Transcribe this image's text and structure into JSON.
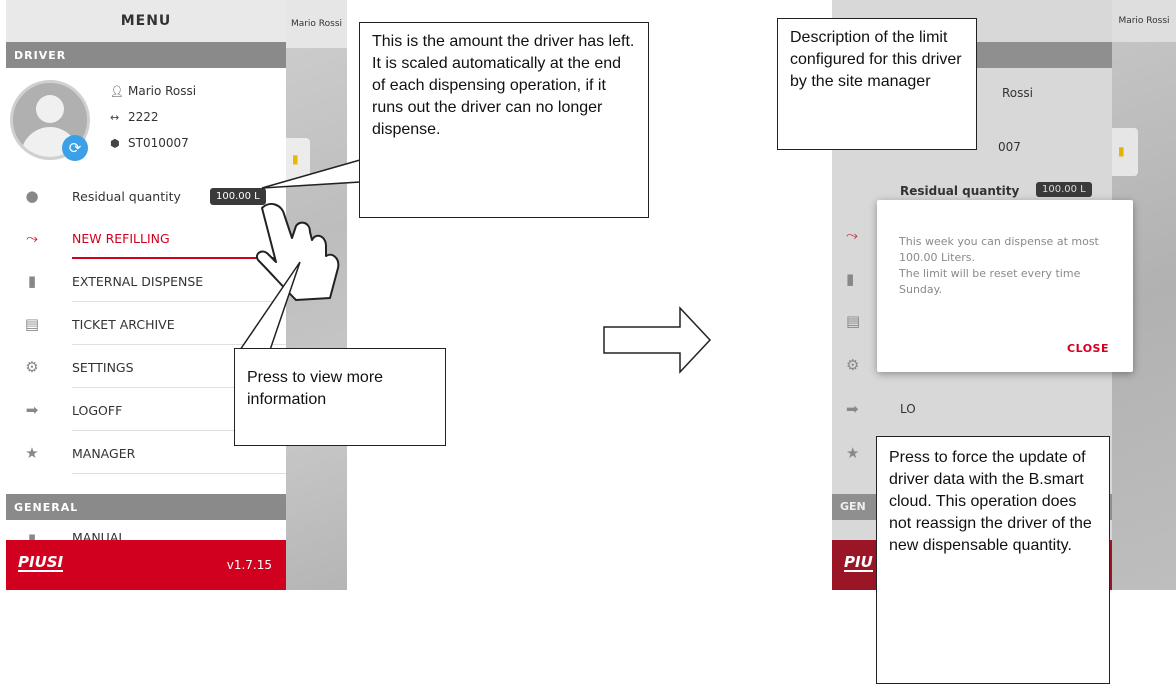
{
  "left_screen": {
    "menu_title": "MENU",
    "driver_section": "DRIVER",
    "user_tag": "Mario Rossi",
    "driver": {
      "name": "Mario Rossi",
      "code": "2222",
      "station": "ST010007"
    },
    "residual": {
      "label": "Residual quantity",
      "value": "100.00 L"
    },
    "items": [
      {
        "label": "NEW REFILLING",
        "icon": "pump-nozzle-icon"
      },
      {
        "label": "EXTERNAL DISPENSE",
        "icon": "fuel-pump-icon"
      },
      {
        "label": "TICKET ARCHIVE",
        "icon": "receipt-icon"
      },
      {
        "label": "SETTINGS",
        "icon": "gear-icon"
      },
      {
        "label": "LOGOFF",
        "icon": "logout-icon"
      },
      {
        "label": "MANAGER",
        "icon": "star-icon"
      }
    ],
    "general_section": "GENERAL",
    "partial_item": "MANUAL",
    "brand": "PIUSI",
    "version": "v1.7.15"
  },
  "callouts": {
    "residual_info": "This is the amount the driver has left. It is scaled automatically at the end of each dispensing operation, if it runs out the driver can no longer dispense.",
    "press_info": "Press to view more information",
    "limit_desc": "Description of the limit configured for this driver by the site manager",
    "force_update": "Press to force the update of driver data with the B.smart cloud. This operation does not reassign the driver of the new dispensable quantity."
  },
  "right_screen": {
    "user_tag": "Mario Rossi",
    "name_fragment": "Rossi",
    "station_fragment": "007",
    "residual": {
      "label": "Residual quantity",
      "value": "100.00 L"
    },
    "logoff_fragment": "LO",
    "general_fragment": "GEN",
    "brand_fragment": "PIU",
    "dialog": {
      "message_line1": "This week you can dispense at most 100.00 Liters.",
      "message_line2": "The limit will be reset every time Sunday.",
      "close_label": "CLOSE"
    }
  },
  "colors": {
    "accent": "#d2001f",
    "sync": "#3aa0e8",
    "section": "#8a8a8a"
  }
}
